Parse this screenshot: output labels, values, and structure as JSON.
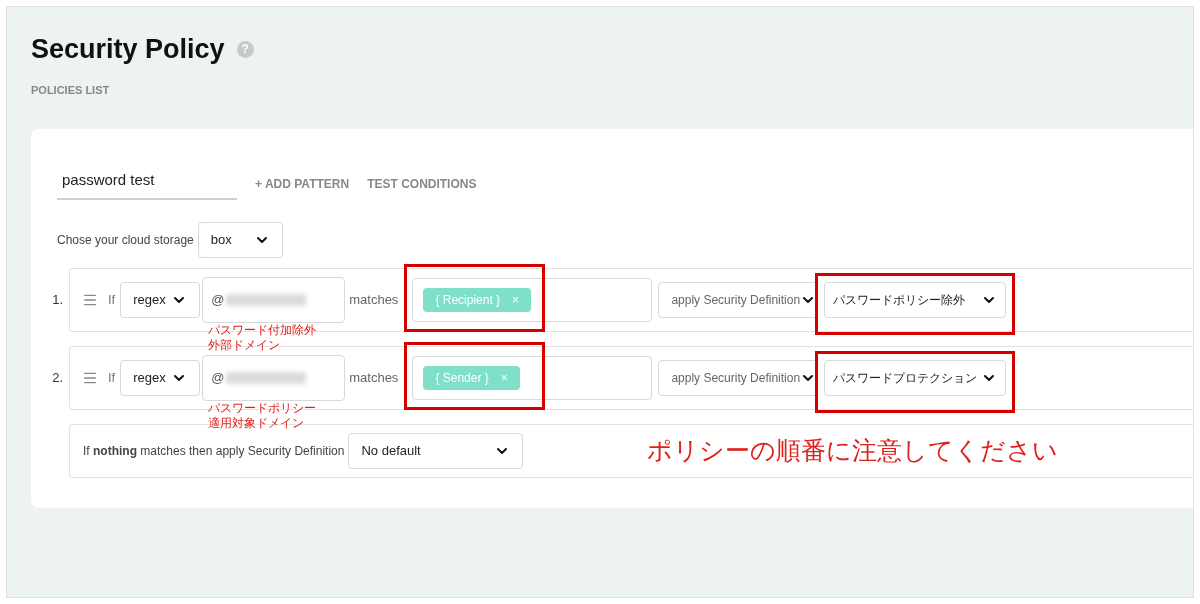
{
  "page": {
    "title": "Security Policy",
    "help": "?",
    "breadcrumb": "POLICIES LIST"
  },
  "policy": {
    "name": "password test",
    "actions": [
      {
        "icon": "+",
        "label": "ADD PATTERN"
      },
      {
        "label": "TEST CONDITIONS"
      }
    ]
  },
  "storage": {
    "label": "Chose your cloud storage",
    "value": "box"
  },
  "rules": [
    {
      "number": "1.",
      "if": "If",
      "operator": "regex",
      "value": "@",
      "redacted": true,
      "matches": "matches",
      "tags": [
        {
          "label": "{ Recipient }",
          "remove": "×"
        }
      ],
      "action": "apply Security Definition",
      "definition": "パスワードポリシー除外",
      "note": [
        "パスワード付加除外",
        "外部ドメイン"
      ],
      "highlighted": true
    },
    {
      "number": "2.",
      "if": "If",
      "operator": "regex",
      "value": "@",
      "redacted": true,
      "matches": "matches",
      "tags": [
        {
          "label": "{ Sender }",
          "remove": "×"
        }
      ],
      "action": "apply Security Definition",
      "definition": "パスワードプロテクション",
      "note": [
        "パスワードポリシー",
        "適用対象ドメイン"
      ],
      "highlighted": true
    }
  ],
  "default": {
    "text": "If **nothing** matches then apply Security Definition",
    "value": "No default"
  },
  "annotation": "ポリシーの順番に注意してください"
}
